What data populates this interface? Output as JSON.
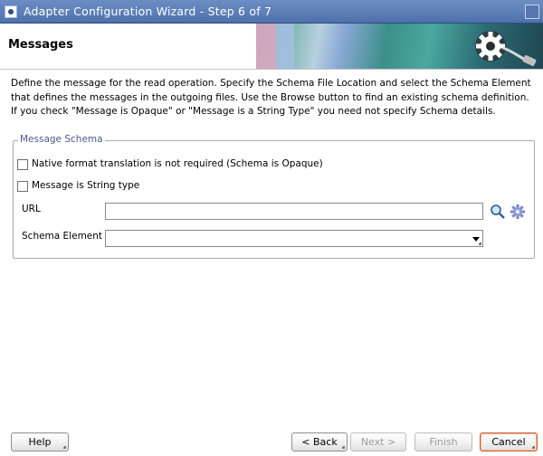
{
  "window": {
    "title": "Adapter Configuration Wizard - Step 6 of 7"
  },
  "header": {
    "title": "Messages"
  },
  "description": "Define the message for the read operation. Specify the Schema File Location and select the Schema Element that defines the messages in the outgoing files. Use the Browse button to find an existing schema definition. If you check \"Message is Opaque\" or \"Message is a String Type\" you need not specify Schema details.",
  "message_schema": {
    "legend": "Message Schema",
    "opaque_checkbox": {
      "label": "Native format translation is not required (Schema is Opaque)",
      "checked": false
    },
    "string_checkbox": {
      "label": "Message is String type",
      "checked": false
    },
    "url": {
      "label": "URL",
      "value": ""
    },
    "schema_element": {
      "label": "Schema Element",
      "value": ""
    }
  },
  "footer": {
    "help": "Help",
    "back": "< Back",
    "next": "Next >",
    "finish": "Finish",
    "cancel": "Cancel"
  },
  "colors": {
    "titlebar": "#5676b0",
    "default_button_border": "#d05e2f",
    "legend_text": "#4a5a8a"
  }
}
